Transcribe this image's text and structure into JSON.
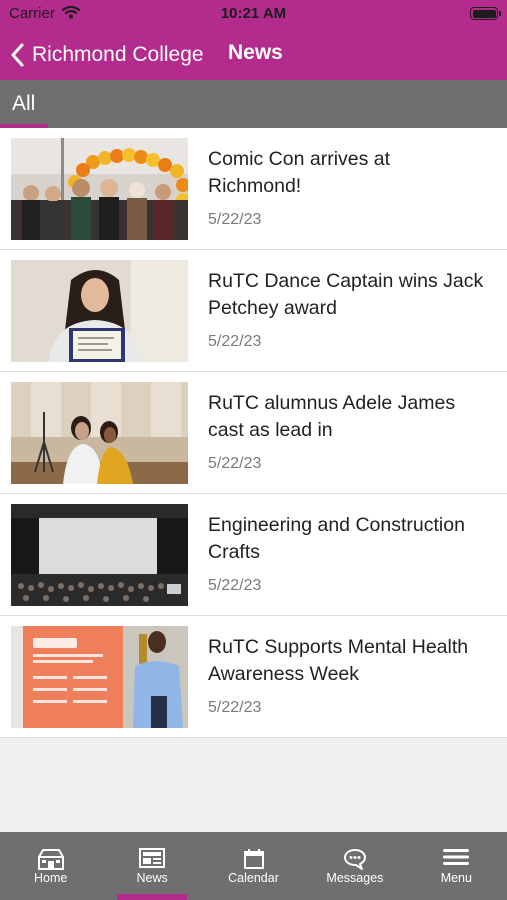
{
  "status_bar": {
    "carrier": "Carrier",
    "time": "10:21 AM",
    "battery_level": 1.0
  },
  "nav": {
    "back_label": "Richmond College",
    "title": "News"
  },
  "filter": {
    "active_tab": "All"
  },
  "news": [
    {
      "title": "Comic Con arrives at Richmond!",
      "date": "5/22/23",
      "thumbnail": "comic-con-photo"
    },
    {
      "title": "RuTC Dance Captain wins Jack Petchey award",
      "date": "5/22/23",
      "thumbnail": "dance-captain-photo"
    },
    {
      "title": "RuTC alumnus Adele James cast as lead in",
      "date": "5/22/23",
      "thumbnail": "alumnus-photo"
    },
    {
      "title": "Engineering and Construction Crafts",
      "date": "5/22/23",
      "thumbnail": "engineering-event-photo"
    },
    {
      "title": "RuTC Supports Mental Health Awareness Week",
      "date": "5/22/23",
      "thumbnail": "mental-health-photo"
    }
  ],
  "tabs": [
    {
      "label": "Home",
      "icon": "home-icon",
      "active": false
    },
    {
      "label": "News",
      "icon": "news-icon",
      "active": true
    },
    {
      "label": "Calendar",
      "icon": "calendar-icon",
      "active": false
    },
    {
      "label": "Messages",
      "icon": "messages-icon",
      "active": false
    },
    {
      "label": "Menu",
      "icon": "menu-icon",
      "active": false
    }
  ],
  "colors": {
    "brand": "#b42b8e",
    "bar_gray": "#6f6f6f"
  }
}
